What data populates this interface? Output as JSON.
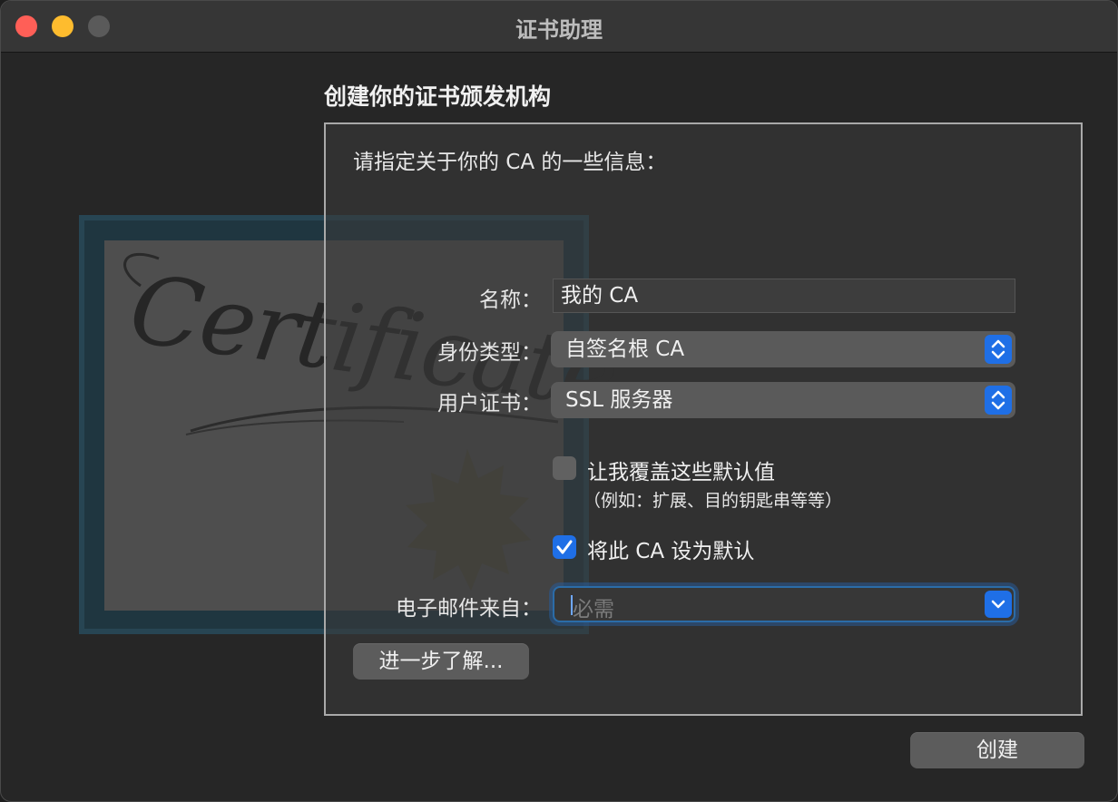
{
  "window": {
    "title": "证书助理"
  },
  "page": {
    "heading": "创建你的证书颁发机构",
    "intro": "请指定关于你的 CA 的一些信息："
  },
  "illustration": {
    "word": "Certificate"
  },
  "form": {
    "name_label": "名称：",
    "name_value": "我的 CA",
    "identity_type_label": "身份类型：",
    "identity_type_value": "自签名根 CA",
    "user_cert_label": "用户证书：",
    "user_cert_value": "SSL 服务器",
    "override_label": "让我覆盖这些默认值",
    "override_checked": false,
    "override_hint": "（例如：扩展、目的钥匙串等等）",
    "default_label": "将此 CA 设为默认",
    "default_checked": true,
    "email_label": "电子邮件来自：",
    "email_placeholder": "必需"
  },
  "buttons": {
    "learn_more": "进一步了解...",
    "create": "创建"
  },
  "colors": {
    "accent": "#1f6fe6",
    "close": "#ff5f57",
    "minimize": "#febc2e"
  }
}
